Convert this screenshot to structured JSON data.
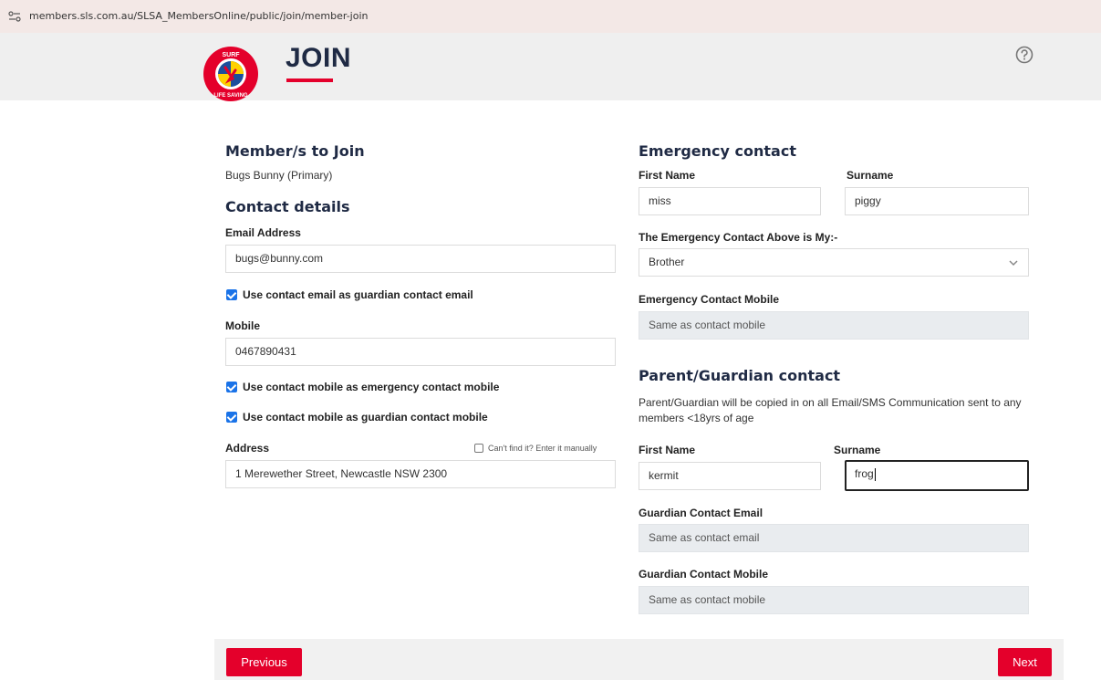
{
  "browser": {
    "url": "members.sls.com.au/SLSA_MembersOnline/public/join/member-join"
  },
  "header": {
    "title": "JOIN",
    "logo_text_top": "SURF",
    "logo_text_bottom": "LIFE SAVING",
    "colors": {
      "accent": "#e4002b",
      "title": "#1f2a44",
      "logo_blue": "#1c4f9c"
    }
  },
  "members": {
    "section_title": "Member/s to Join",
    "primary": "Bugs Bunny (Primary)"
  },
  "contact": {
    "section_title": "Contact details",
    "email_label": "Email Address",
    "email_value": "bugs@bunny.com",
    "use_email_guardian": "Use contact email as guardian contact email",
    "mobile_label": "Mobile",
    "mobile_value": "0467890431",
    "use_mobile_emergency": "Use contact mobile as emergency contact mobile",
    "use_mobile_guardian": "Use contact mobile as guardian contact mobile",
    "address_label": "Address",
    "address_manual": "Can't find it? Enter it manually",
    "address_value": "1 Merewether Street, Newcastle NSW 2300"
  },
  "emergency": {
    "section_title": "Emergency contact",
    "first_name_label": "First Name",
    "first_name_value": "miss",
    "surname_label": "Surname",
    "surname_value": "piggy",
    "relation_label": "The Emergency Contact Above is My:-",
    "relation_value": "Brother",
    "mobile_label": "Emergency Contact Mobile",
    "mobile_placeholder": "Same as contact mobile"
  },
  "guardian": {
    "section_title": "Parent/Guardian contact",
    "description": "Parent/Guardian will be copied in on all Email/SMS Communication sent to any members <18yrs of age",
    "first_name_label": "First Name",
    "first_name_value": "kermit",
    "surname_label": "Surname",
    "surname_value": "frog",
    "email_label": "Guardian Contact Email",
    "email_placeholder": "Same as contact email",
    "mobile_label": "Guardian Contact Mobile",
    "mobile_placeholder": "Same as contact mobile"
  },
  "footer": {
    "previous_label": "Previous",
    "next_label": "Next"
  },
  "icons": {
    "site_info": "site-settings-icon",
    "help": "help-circle-icon",
    "select": "chevron-down-icon"
  }
}
